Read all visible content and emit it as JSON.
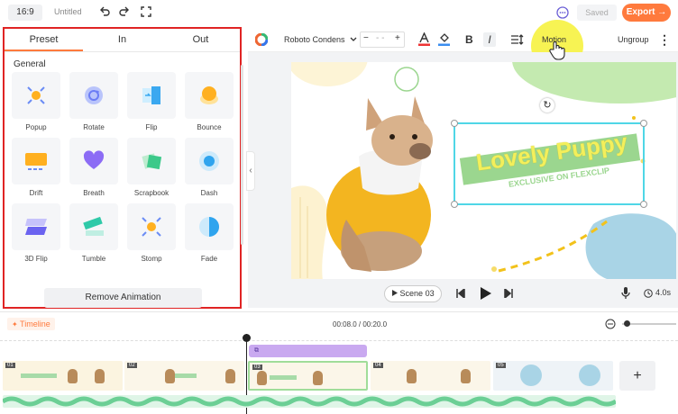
{
  "topbar": {
    "ratio": "16:9",
    "title": "Untitled",
    "saved": "Saved",
    "export": "Export",
    "export_arrow": "→"
  },
  "panel": {
    "tabs": [
      {
        "label": "Preset",
        "active": true
      },
      {
        "label": "In",
        "active": false
      },
      {
        "label": "Out",
        "active": false
      }
    ],
    "section": "General",
    "animations": [
      {
        "label": "Popup",
        "icon": "popup-icon"
      },
      {
        "label": "Rotate",
        "icon": "rotate-icon"
      },
      {
        "label": "Flip",
        "icon": "flip-icon"
      },
      {
        "label": "Bounce",
        "icon": "bounce-icon"
      },
      {
        "label": "Drift",
        "icon": "drift-icon"
      },
      {
        "label": "Breath",
        "icon": "heart-icon"
      },
      {
        "label": "Scrapbook",
        "icon": "scrapbook-icon"
      },
      {
        "label": "Dash",
        "icon": "dash-icon"
      },
      {
        "label": "3D Flip",
        "icon": "3d-flip-icon"
      },
      {
        "label": "Tumble",
        "icon": "tumble-icon"
      },
      {
        "label": "Stomp",
        "icon": "stomp-icon"
      },
      {
        "label": "Fade",
        "icon": "fade-icon"
      }
    ],
    "remove": "Remove Animation",
    "collapse": "‹"
  },
  "toolbar": {
    "font": "Roboto Condens",
    "font_size": "- -",
    "minus": "−",
    "plus": "+",
    "bold": "B",
    "italic": "I",
    "motion": "Motion",
    "ungroup": "Ungroup",
    "more": "⋮"
  },
  "canvas": {
    "title_line1": "Lovely Puppy",
    "title_line2": "EXCLUSIVE ON FLEXCLIP",
    "refresh": "↻"
  },
  "playbar": {
    "scene_label": "Scene",
    "scene_number": "03",
    "duration": "4.0s"
  },
  "timeline": {
    "label": "Timeline",
    "time": "00:08.0 / 00:20.0",
    "scene_markers": [
      "01",
      "02",
      "03",
      "04",
      "05"
    ],
    "add": "+"
  },
  "colors": {
    "accent": "#ff7a3d",
    "highlight": "#e02424",
    "motion_glow": "#f7f24a",
    "text_title": "#f3ef5b",
    "text_band": "#9bd68f",
    "audio": "#9fe0b4",
    "track": "#c9a9f0"
  }
}
